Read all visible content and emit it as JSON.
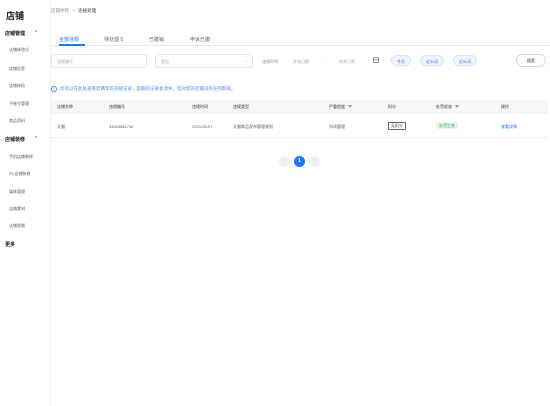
{
  "sidebar": {
    "brand": "店铺",
    "group1": {
      "label": "店铺管理",
      "chevron": "^"
    },
    "group1_items": [
      "店铺体验分",
      "店铺信息",
      "店铺体检",
      "子账号管理",
      "商品资料"
    ],
    "group2": {
      "label": "店铺装修",
      "chevron": "^"
    },
    "group2_items": [
      "手机店铺装修",
      "PC店铺装修",
      "媒体管理",
      "店铺素材",
      "店铺视频"
    ],
    "more": "更多"
  },
  "breadcrumb": {
    "parent": "店铺体检",
    "separator": ">",
    "current": "违规处理"
  },
  "tabs": [
    {
      "label": "全部违规",
      "active": true
    },
    {
      "label": "待处理 0",
      "active": false
    },
    {
      "label": "已撤销",
      "active": false
    },
    {
      "label": "申诉已撤",
      "active": false
    }
  ],
  "filters": {
    "violation_no_placeholder": "违规编号",
    "type_placeholder": "类型",
    "date_label": "违规时间",
    "start_placeholder": "开始日期",
    "date_separator": "-",
    "end_placeholder": "结束日期",
    "chips": [
      "今天",
      "近30天",
      "近90天"
    ],
    "search_label": "搜索"
  },
  "notice": {
    "icon": "info-icon",
    "text": "您可以在此处查看近两年的违规记录，超期的记录会消失，但对您的店铺没有任何影响。"
  },
  "table": {
    "headers": [
      "店铺名称",
      "违规编号",
      "违规时间",
      "违规类型",
      "严重程度",
      "扣分",
      "处罚状态",
      "操作"
    ],
    "rows": [
      {
        "shop": "天猫",
        "violation_no": "33015581742",
        "time": "2023-05-07",
        "type": "天猫商品发布管理规则",
        "severity": "市场管理",
        "deduction": "无扣分",
        "status": "处罚生效",
        "action": "查看详情"
      }
    ]
  },
  "pagination": {
    "prev": "‹",
    "current": "1",
    "next": "›"
  },
  "colors": {
    "accent": "#1677ff",
    "status_green": "#2fae4f"
  }
}
